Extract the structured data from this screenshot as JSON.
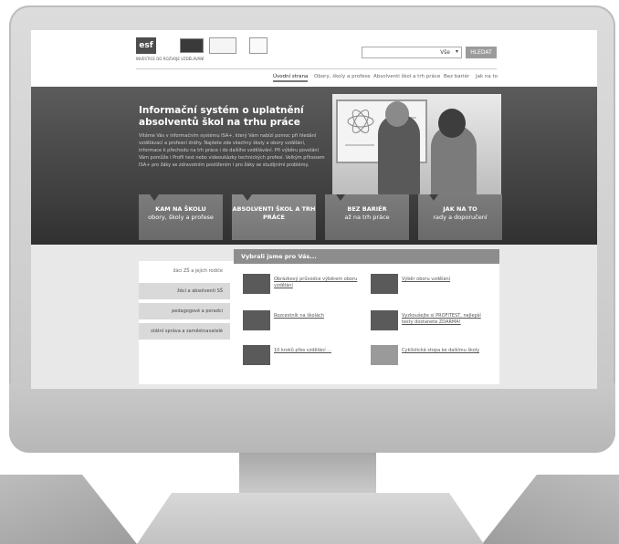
{
  "header": {
    "logo_esf": "esf",
    "logo_tagline": "INVESTICE DO ROZVOJE VZDĚLÁVÁNÍ",
    "search_option": "Vše",
    "search_button": "HLEDAT"
  },
  "nav": {
    "items": [
      {
        "label": "Úvodní strana",
        "active": true
      },
      {
        "label": "Obory, školy a profese",
        "active": false
      },
      {
        "label": "Absolventi škol a trh práce",
        "active": false
      },
      {
        "label": "Bez bariér",
        "active": false
      },
      {
        "label": "Jak na to",
        "active": false
      }
    ]
  },
  "hero": {
    "title": "Informační systém o uplatnění absolventů škol na trhu práce",
    "text": "Vítáme Vás v informačním systému ISA+, který Vám nabízí pomoc při hledání vzdělávací a profesní dráhy. Najdete zde všechny školy a obory vzdělání, informace k přechodu na trh práce i do dalšího vzdělávání. Při výběru povolání Vám pomůže i Profil test nebo videoukázky technických profesí. Velkým přínosem ISA+ pro žáky se zdravotním postižením i pro žáky se studijními problémy."
  },
  "tiles": [
    {
      "title": "KAM NA ŠKOLU",
      "sub": "obory, školy a profese"
    },
    {
      "title": "ABSOLVENTI ŠKOL A TRH PRÁCE",
      "sub": ""
    },
    {
      "title": "BEZ BARIÉR",
      "sub": "až na trh práce"
    },
    {
      "title": "JAK NA TO",
      "sub": "rady a doporučení"
    }
  ],
  "sidebar": {
    "items": [
      {
        "label": "žáci ZŠ a jejich rodiče",
        "active": true
      },
      {
        "label": "žáci a absolventi SŠ",
        "active": false
      },
      {
        "label": "pedagogové a poradci",
        "active": false
      },
      {
        "label": "státní správa a zaměstnavatelé",
        "active": false
      }
    ]
  },
  "recommend": {
    "title": "Vybrali jsme pro Vás...",
    "items": [
      "Obrázkový průvodce výběrem oboru vzdělání",
      "Výběr oboru vzdělání",
      "Rozcestník na školách",
      "Vyzkoušejte si PROFITEST, nejlepší testy dostanete ZDARMA!",
      "10 kroků přes vzdělání ...",
      "Cyklistická stopa ke dalšímu školy"
    ]
  }
}
